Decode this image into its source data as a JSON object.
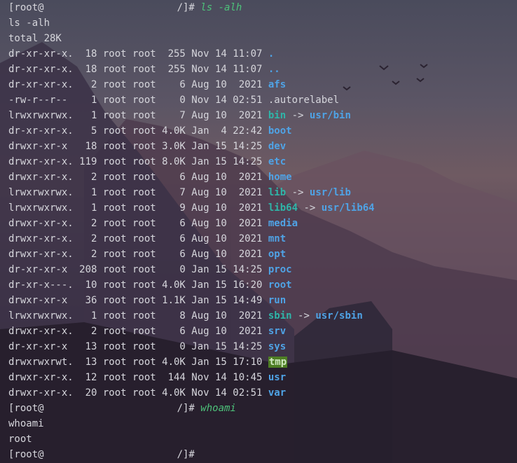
{
  "prompt_prefix": "[root@",
  "prompt_suffix": "/]# ",
  "cmd1": "ls -alh",
  "echo1": "ls -alh",
  "total": "total 28K",
  "rows": [
    {
      "perm": "dr-xr-xr-x.",
      "links": " 18",
      "owner": "root",
      "group": "root",
      "size": " 255",
      "date": "Nov 14 11:07",
      "name": ".",
      "kind": "dir"
    },
    {
      "perm": "dr-xr-xr-x.",
      "links": " 18",
      "owner": "root",
      "group": "root",
      "size": " 255",
      "date": "Nov 14 11:07",
      "name": "..",
      "kind": "dir"
    },
    {
      "perm": "dr-xr-xr-x.",
      "links": "  2",
      "owner": "root",
      "group": "root",
      "size": "   6",
      "date": "Aug 10  2021",
      "name": "afs",
      "kind": "dir"
    },
    {
      "perm": "-rw-r--r--",
      "links": "   1",
      "owner": "root",
      "group": "root",
      "size": "   0",
      "date": "Nov 14 02:51",
      "name": ".autorelabel",
      "kind": "plain"
    },
    {
      "perm": "lrwxrwxrwx.",
      "links": "  1",
      "owner": "root",
      "group": "root",
      "size": "   7",
      "date": "Aug 10  2021",
      "name": "bin",
      "kind": "link",
      "target": "usr/bin"
    },
    {
      "perm": "dr-xr-xr-x.",
      "links": "  5",
      "owner": "root",
      "group": "root",
      "size": "4.0K",
      "date": "Jan  4 22:42",
      "name": "boot",
      "kind": "dir"
    },
    {
      "perm": "drwxr-xr-x",
      "links": "  18",
      "owner": "root",
      "group": "root",
      "size": "3.0K",
      "date": "Jan 15 14:25",
      "name": "dev",
      "kind": "dir"
    },
    {
      "perm": "drwxr-xr-x.",
      "links": "119",
      "owner": "root",
      "group": "root",
      "size": "8.0K",
      "date": "Jan 15 14:25",
      "name": "etc",
      "kind": "dir"
    },
    {
      "perm": "drwxr-xr-x.",
      "links": "  2",
      "owner": "root",
      "group": "root",
      "size": "   6",
      "date": "Aug 10  2021",
      "name": "home",
      "kind": "dir"
    },
    {
      "perm": "lrwxrwxrwx.",
      "links": "  1",
      "owner": "root",
      "group": "root",
      "size": "   7",
      "date": "Aug 10  2021",
      "name": "lib",
      "kind": "link",
      "target": "usr/lib"
    },
    {
      "perm": "lrwxrwxrwx.",
      "links": "  1",
      "owner": "root",
      "group": "root",
      "size": "   9",
      "date": "Aug 10  2021",
      "name": "lib64",
      "kind": "link",
      "target": "usr/lib64"
    },
    {
      "perm": "drwxr-xr-x.",
      "links": "  2",
      "owner": "root",
      "group": "root",
      "size": "   6",
      "date": "Aug 10  2021",
      "name": "media",
      "kind": "dir"
    },
    {
      "perm": "drwxr-xr-x.",
      "links": "  2",
      "owner": "root",
      "group": "root",
      "size": "   6",
      "date": "Aug 10  2021",
      "name": "mnt",
      "kind": "dir"
    },
    {
      "perm": "drwxr-xr-x.",
      "links": "  2",
      "owner": "root",
      "group": "root",
      "size": "   6",
      "date": "Aug 10  2021",
      "name": "opt",
      "kind": "dir"
    },
    {
      "perm": "dr-xr-xr-x",
      "links": " 208",
      "owner": "root",
      "group": "root",
      "size": "   0",
      "date": "Jan 15 14:25",
      "name": "proc",
      "kind": "dir"
    },
    {
      "perm": "dr-xr-x---.",
      "links": " 10",
      "owner": "root",
      "group": "root",
      "size": "4.0K",
      "date": "Jan 15 16:20",
      "name": "root",
      "kind": "dir"
    },
    {
      "perm": "drwxr-xr-x",
      "links": "  36",
      "owner": "root",
      "group": "root",
      "size": "1.1K",
      "date": "Jan 15 14:49",
      "name": "run",
      "kind": "dir"
    },
    {
      "perm": "lrwxrwxrwx.",
      "links": "  1",
      "owner": "root",
      "group": "root",
      "size": "   8",
      "date": "Aug 10  2021",
      "name": "sbin",
      "kind": "link",
      "target": "usr/sbin"
    },
    {
      "perm": "drwxr-xr-x.",
      "links": "  2",
      "owner": "root",
      "group": "root",
      "size": "   6",
      "date": "Aug 10  2021",
      "name": "srv",
      "kind": "dir"
    },
    {
      "perm": "dr-xr-xr-x",
      "links": "  13",
      "owner": "root",
      "group": "root",
      "size": "   0",
      "date": "Jan 15 14:25",
      "name": "sys",
      "kind": "dir"
    },
    {
      "perm": "drwxrwxrwt.",
      "links": " 13",
      "owner": "root",
      "group": "root",
      "size": "4.0K",
      "date": "Jan 15 17:10",
      "name": "tmp",
      "kind": "tmp"
    },
    {
      "perm": "drwxr-xr-x.",
      "links": " 12",
      "owner": "root",
      "group": "root",
      "size": " 144",
      "date": "Nov 14 10:45",
      "name": "usr",
      "kind": "dir"
    },
    {
      "perm": "drwxr-xr-x.",
      "links": " 20",
      "owner": "root",
      "group": "root",
      "size": "4.0K",
      "date": "Nov 14 02:51",
      "name": "var",
      "kind": "dir"
    }
  ],
  "cmd2": "whoami",
  "echo2": "whoami",
  "out2": "root",
  "arrow": " -> ",
  "colors": {
    "dir": "#4fa3e6",
    "link": "#2fb5a8",
    "tmp_bg": "#4e7e24",
    "cmd": "#4dc27a"
  }
}
